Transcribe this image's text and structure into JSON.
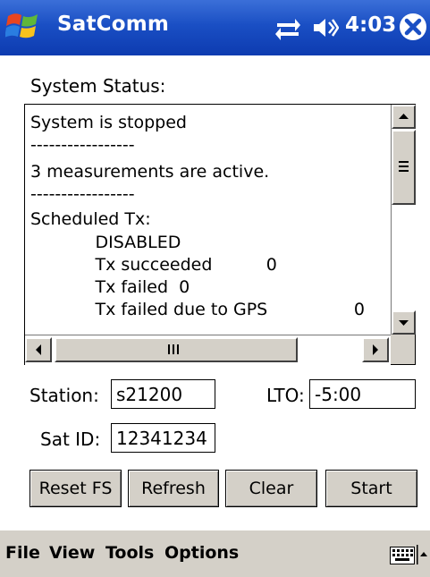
{
  "titlebar": {
    "app_title": "SatComm",
    "time": "4:03",
    "icons": [
      "windows-start-icon",
      "sync-icon",
      "speaker-icon",
      "close-icon"
    ]
  },
  "status": {
    "label": "System Status:",
    "lines": [
      "System is stopped",
      "-----------------",
      "3 measurements are active.",
      "-----------------",
      "Scheduled Tx:",
      "            DISABLED",
      "            Tx succeeded          0",
      "            Tx failed  0",
      "            Tx failed due to GPS                0"
    ]
  },
  "fields": {
    "station_label": "Station:",
    "station_value": "s21200",
    "lto_label": "LTO:",
    "lto_value": "-5:00",
    "satid_label": "Sat ID:",
    "satid_value": "12341234"
  },
  "buttons": {
    "reset_fs": "Reset FS",
    "refresh": "Refresh",
    "clear": "Clear",
    "start": "Start"
  },
  "menu": {
    "file": "File",
    "view": "View",
    "tools": "Tools",
    "options": "Options"
  },
  "colors": {
    "titlebar": "#1a4fc4",
    "chrome": "#d4d0c8"
  }
}
